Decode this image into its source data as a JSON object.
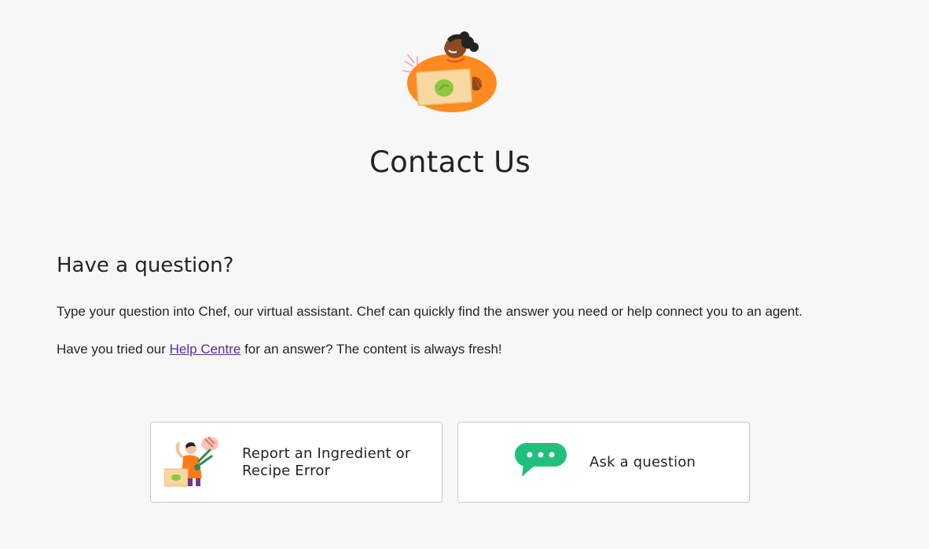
{
  "hero": {
    "illustration": "person-holding-box-illustration",
    "title": "Contact Us"
  },
  "question_section": {
    "heading": "Have a question?",
    "paragraph1": "Type your question into Chef, our virtual assistant. Chef can quickly find the answer you need or help connect you to an agent.",
    "paragraph2_before": "Have you tried our ",
    "help_link": "Help Centre",
    "paragraph2_after": " for an answer? The content is always fresh!"
  },
  "cards": {
    "report": {
      "icon": "chef-with-box-illustration",
      "label_line1": "Report an Ingredient or",
      "label_line2": "Recipe Error"
    },
    "ask": {
      "icon": "chat-bubble-icon",
      "label": "Ask a question"
    }
  },
  "colors": {
    "background": "#f7f7f7",
    "accent_orange": "#ff8a1f",
    "lime": "#8dc63f",
    "chat_green": "#1fc07a",
    "link_purple": "#5c2d91"
  }
}
